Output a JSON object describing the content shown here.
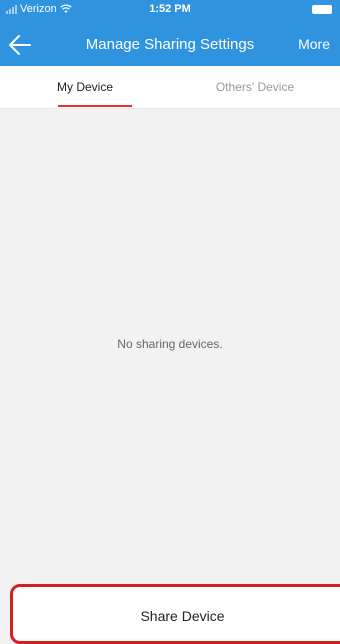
{
  "status_bar": {
    "carrier": "Verizon",
    "time": "1:52 PM"
  },
  "nav": {
    "title": "Manage Sharing Settings",
    "more_label": "More"
  },
  "tabs": [
    {
      "label": "My Device",
      "active": true
    },
    {
      "label": "Others' Device",
      "active": false
    }
  ],
  "empty_state": {
    "message": "No sharing devices."
  },
  "share_button": {
    "label": "Share Device"
  },
  "colors": {
    "header": "#2f93df",
    "accent": "#e0313a",
    "highlight": "#d62020"
  },
  "icons": {
    "back": "arrow-left-icon",
    "wifi": "wifi-icon",
    "signal": "signal-icon",
    "battery": "battery-icon"
  }
}
